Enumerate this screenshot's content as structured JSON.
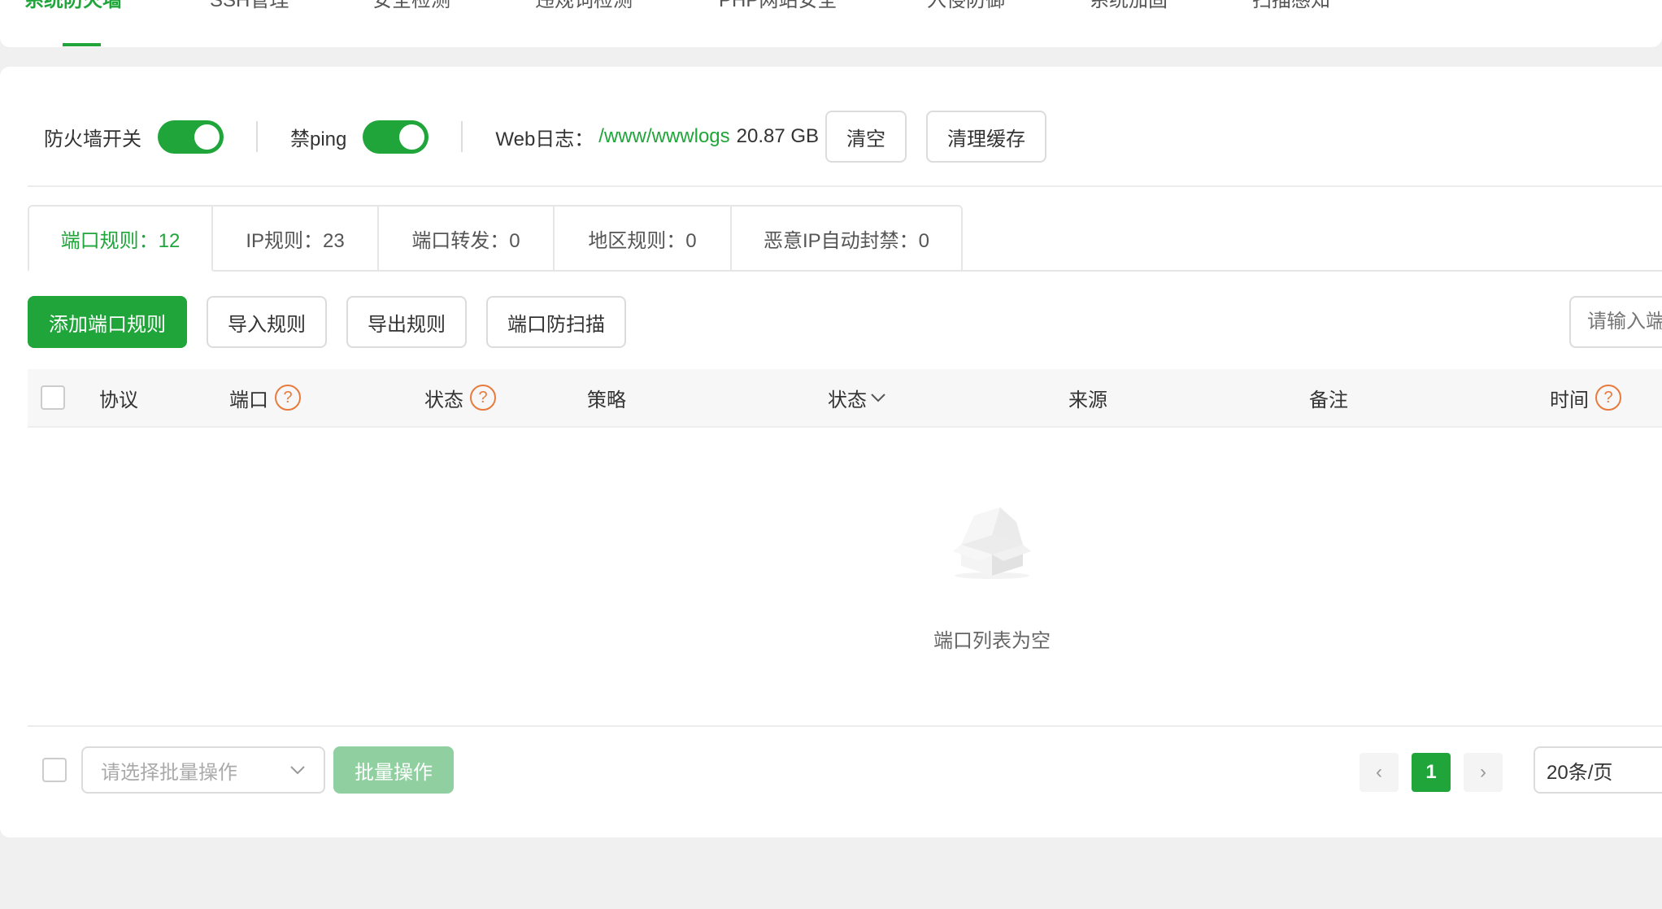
{
  "top_tabs": [
    {
      "label": "系统防火墙",
      "active": true
    },
    {
      "label": "SSH管理"
    },
    {
      "label": "安全检测"
    },
    {
      "label": "违规词检测"
    },
    {
      "label": "PHP网站安全"
    },
    {
      "label": "入侵防御"
    },
    {
      "label": "系统加固"
    },
    {
      "label": "扫描感知"
    }
  ],
  "toolbar": {
    "firewall_label": "防火墙开关",
    "firewall_on": true,
    "ping_label": "禁ping",
    "ping_on": true,
    "weblog_label": "Web日志：",
    "weblog_path": "/www/wwwlogs",
    "weblog_size": "20.87 GB",
    "clear_label": "清空",
    "clear_cache_label": "清理缓存"
  },
  "rule_tabs": [
    {
      "label": "端口规则：12",
      "active": true
    },
    {
      "label": "IP规则：23"
    },
    {
      "label": "端口转发：0"
    },
    {
      "label": "地区规则：0"
    },
    {
      "label": "恶意IP自动封禁：0"
    }
  ],
  "actions": {
    "add_port_rule": "添加端口规则",
    "import_rules": "导入规则",
    "export_rules": "导出规则",
    "port_anti_scan": "端口防扫描",
    "search_placeholder": "请输入端口"
  },
  "table": {
    "columns": {
      "protocol": "协议",
      "port": "端口",
      "status": "状态",
      "policy": "策略",
      "state": "状态",
      "source": "来源",
      "remark": "备注",
      "time": "时间"
    },
    "help_glyph": "?",
    "empty_text": "端口列表为空"
  },
  "footer": {
    "bulk_select_placeholder": "请选择批量操作",
    "bulk_button": "批量操作",
    "prev_glyph": "‹",
    "current_page": "1",
    "next_glyph": "›",
    "per_page": "20条/页"
  },
  "colors": {
    "accent": "#20a53a",
    "help": "#e87a3d"
  }
}
